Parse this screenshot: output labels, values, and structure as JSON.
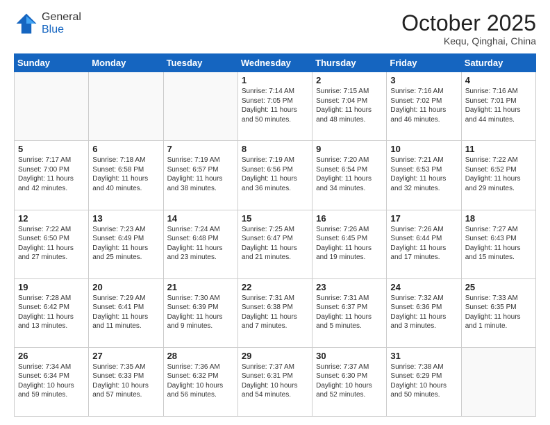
{
  "header": {
    "logo_line1": "General",
    "logo_line2": "Blue",
    "month": "October 2025",
    "location": "Kequ, Qinghai, China"
  },
  "days_of_week": [
    "Sunday",
    "Monday",
    "Tuesday",
    "Wednesday",
    "Thursday",
    "Friday",
    "Saturday"
  ],
  "weeks": [
    [
      {
        "day": "",
        "info": ""
      },
      {
        "day": "",
        "info": ""
      },
      {
        "day": "",
        "info": ""
      },
      {
        "day": "1",
        "info": "Sunrise: 7:14 AM\nSunset: 7:05 PM\nDaylight: 11 hours and 50 minutes."
      },
      {
        "day": "2",
        "info": "Sunrise: 7:15 AM\nSunset: 7:04 PM\nDaylight: 11 hours and 48 minutes."
      },
      {
        "day": "3",
        "info": "Sunrise: 7:16 AM\nSunset: 7:02 PM\nDaylight: 11 hours and 46 minutes."
      },
      {
        "day": "4",
        "info": "Sunrise: 7:16 AM\nSunset: 7:01 PM\nDaylight: 11 hours and 44 minutes."
      }
    ],
    [
      {
        "day": "5",
        "info": "Sunrise: 7:17 AM\nSunset: 7:00 PM\nDaylight: 11 hours and 42 minutes."
      },
      {
        "day": "6",
        "info": "Sunrise: 7:18 AM\nSunset: 6:58 PM\nDaylight: 11 hours and 40 minutes."
      },
      {
        "day": "7",
        "info": "Sunrise: 7:19 AM\nSunset: 6:57 PM\nDaylight: 11 hours and 38 minutes."
      },
      {
        "day": "8",
        "info": "Sunrise: 7:19 AM\nSunset: 6:56 PM\nDaylight: 11 hours and 36 minutes."
      },
      {
        "day": "9",
        "info": "Sunrise: 7:20 AM\nSunset: 6:54 PM\nDaylight: 11 hours and 34 minutes."
      },
      {
        "day": "10",
        "info": "Sunrise: 7:21 AM\nSunset: 6:53 PM\nDaylight: 11 hours and 32 minutes."
      },
      {
        "day": "11",
        "info": "Sunrise: 7:22 AM\nSunset: 6:52 PM\nDaylight: 11 hours and 29 minutes."
      }
    ],
    [
      {
        "day": "12",
        "info": "Sunrise: 7:22 AM\nSunset: 6:50 PM\nDaylight: 11 hours and 27 minutes."
      },
      {
        "day": "13",
        "info": "Sunrise: 7:23 AM\nSunset: 6:49 PM\nDaylight: 11 hours and 25 minutes."
      },
      {
        "day": "14",
        "info": "Sunrise: 7:24 AM\nSunset: 6:48 PM\nDaylight: 11 hours and 23 minutes."
      },
      {
        "day": "15",
        "info": "Sunrise: 7:25 AM\nSunset: 6:47 PM\nDaylight: 11 hours and 21 minutes."
      },
      {
        "day": "16",
        "info": "Sunrise: 7:26 AM\nSunset: 6:45 PM\nDaylight: 11 hours and 19 minutes."
      },
      {
        "day": "17",
        "info": "Sunrise: 7:26 AM\nSunset: 6:44 PM\nDaylight: 11 hours and 17 minutes."
      },
      {
        "day": "18",
        "info": "Sunrise: 7:27 AM\nSunset: 6:43 PM\nDaylight: 11 hours and 15 minutes."
      }
    ],
    [
      {
        "day": "19",
        "info": "Sunrise: 7:28 AM\nSunset: 6:42 PM\nDaylight: 11 hours and 13 minutes."
      },
      {
        "day": "20",
        "info": "Sunrise: 7:29 AM\nSunset: 6:41 PM\nDaylight: 11 hours and 11 minutes."
      },
      {
        "day": "21",
        "info": "Sunrise: 7:30 AM\nSunset: 6:39 PM\nDaylight: 11 hours and 9 minutes."
      },
      {
        "day": "22",
        "info": "Sunrise: 7:31 AM\nSunset: 6:38 PM\nDaylight: 11 hours and 7 minutes."
      },
      {
        "day": "23",
        "info": "Sunrise: 7:31 AM\nSunset: 6:37 PM\nDaylight: 11 hours and 5 minutes."
      },
      {
        "day": "24",
        "info": "Sunrise: 7:32 AM\nSunset: 6:36 PM\nDaylight: 11 hours and 3 minutes."
      },
      {
        "day": "25",
        "info": "Sunrise: 7:33 AM\nSunset: 6:35 PM\nDaylight: 11 hours and 1 minute."
      }
    ],
    [
      {
        "day": "26",
        "info": "Sunrise: 7:34 AM\nSunset: 6:34 PM\nDaylight: 10 hours and 59 minutes."
      },
      {
        "day": "27",
        "info": "Sunrise: 7:35 AM\nSunset: 6:33 PM\nDaylight: 10 hours and 57 minutes."
      },
      {
        "day": "28",
        "info": "Sunrise: 7:36 AM\nSunset: 6:32 PM\nDaylight: 10 hours and 56 minutes."
      },
      {
        "day": "29",
        "info": "Sunrise: 7:37 AM\nSunset: 6:31 PM\nDaylight: 10 hours and 54 minutes."
      },
      {
        "day": "30",
        "info": "Sunrise: 7:37 AM\nSunset: 6:30 PM\nDaylight: 10 hours and 52 minutes."
      },
      {
        "day": "31",
        "info": "Sunrise: 7:38 AM\nSunset: 6:29 PM\nDaylight: 10 hours and 50 minutes."
      },
      {
        "day": "",
        "info": ""
      }
    ]
  ]
}
